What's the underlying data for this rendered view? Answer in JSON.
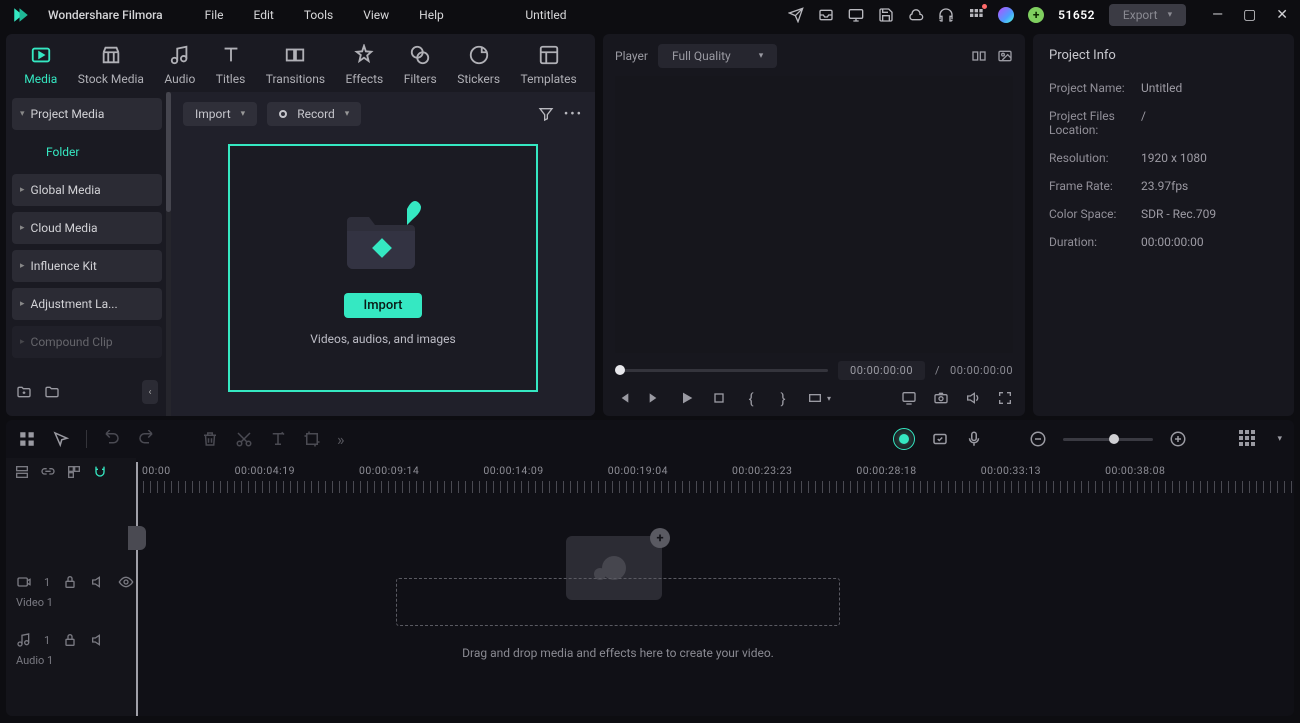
{
  "titlebar": {
    "brand": "Wondershare Filmora",
    "menus": [
      "File",
      "Edit",
      "Tools",
      "View",
      "Help"
    ],
    "project_title": "Untitled",
    "credits": "51652",
    "export_label": "Export"
  },
  "tabs": [
    "Media",
    "Stock Media",
    "Audio",
    "Titles",
    "Transitions",
    "Effects",
    "Filters",
    "Stickers",
    "Templates"
  ],
  "sidebar": {
    "items": [
      "Project Media",
      "Folder",
      "Global Media",
      "Cloud Media",
      "Influence Kit",
      "Adjustment La...",
      "Compound Clip"
    ]
  },
  "browse_bar": {
    "import": "Import",
    "record": "Record"
  },
  "dropzone": {
    "button": "Import",
    "hint": "Videos, audios, and images"
  },
  "player": {
    "label": "Player",
    "quality": "Full Quality",
    "time_cur": "00:00:00:00",
    "time_sep": "/",
    "time_dur": "00:00:00:00"
  },
  "project_info": {
    "title": "Project Info",
    "rows": [
      {
        "label": "Project Name:",
        "value": "Untitled"
      },
      {
        "label": "Project Files Location:",
        "value": "/"
      },
      {
        "label": "Resolution:",
        "value": "1920 x 1080"
      },
      {
        "label": "Frame Rate:",
        "value": "23.97fps"
      },
      {
        "label": "Color Space:",
        "value": "SDR - Rec.709"
      },
      {
        "label": "Duration:",
        "value": "00:00:00:00"
      }
    ]
  },
  "timeline": {
    "ruler": [
      "00:00",
      "00:00:04:19",
      "00:00:09:14",
      "00:00:14:09",
      "00:00:19:04",
      "00:00:23:23",
      "00:00:28:18",
      "00:00:33:13",
      "00:00:38:08"
    ],
    "video_index": "1",
    "video_track": "Video 1",
    "audio_index": "1",
    "audio_track": "Audio 1",
    "drop_hint": "Drag and drop media and effects here to create your video."
  }
}
